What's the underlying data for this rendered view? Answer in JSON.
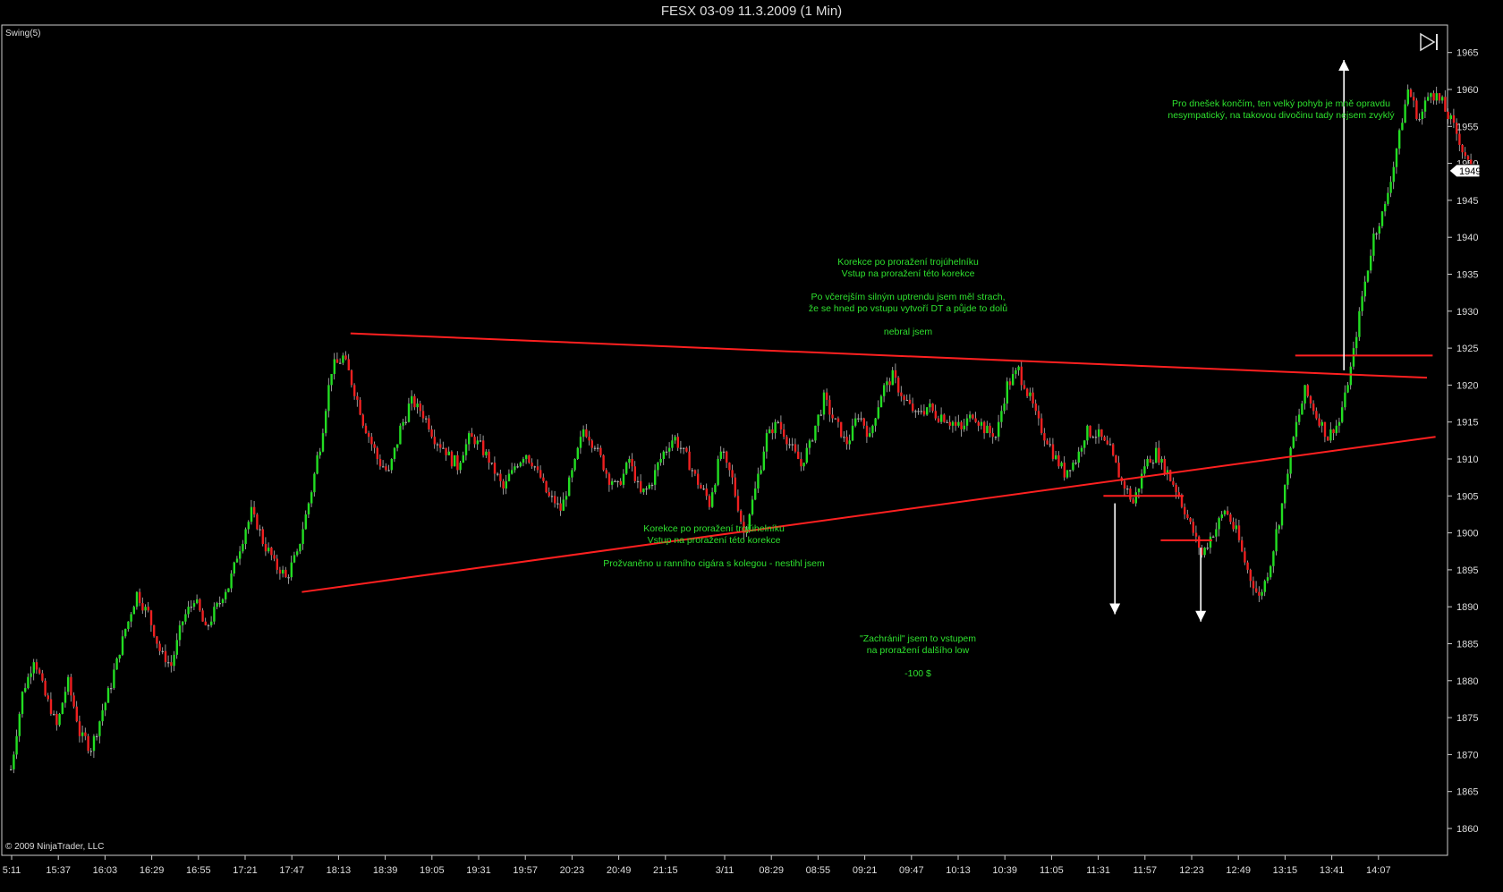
{
  "window": {
    "title": "FESX 03-09  11.3.2009 (1 Min)"
  },
  "indicator_label": "Swing(5)",
  "copyright": "© 2009 NinjaTrader, LLC",
  "price_marker": "1949",
  "icons": {
    "playback": "skip-forward-icon"
  },
  "colors": {
    "background": "#000000",
    "up_bar": "#22dd22",
    "down_bar": "#ee2020",
    "neutral_bar": "#aaaaaa",
    "trendline": "#ff2020",
    "annotation_text": "#2ee02e",
    "arrow": "#ffffff",
    "axis_text": "#dddddd"
  },
  "annotations": [
    {
      "id": "a1",
      "text": "Pro dnešek končím, ten velký pohyb je mně opravdu\nnesympatický, na takovou divočinu tady nejsem zvyklý"
    },
    {
      "id": "a2",
      "text": "Korekce po proražení trojúhelníku\nVstup na proražení této korekce\n\nPo včerejším silným uptrendu jsem měl strach,\nže se hned po vstupu vytvoří DT a půjde to dolů\n\nnebral jsem"
    },
    {
      "id": "a3",
      "text": "Korekce po proražení trojúhelníku\nVstup na proražení této korekce\n\nProžvaněno u ranního cigára s kolegou - nestihl jsem"
    },
    {
      "id": "a4",
      "text": "\"Zachránil\" jsem to vstupem\nna proražení dalšího low\n\n-100 $"
    }
  ],
  "chart_data": {
    "type": "candlestick",
    "title": "FESX 03-09  11.3.2009 (1 Min)",
    "y_axis": {
      "ticks": [
        1860,
        1865,
        1870,
        1875,
        1880,
        1885,
        1890,
        1895,
        1900,
        1905,
        1910,
        1915,
        1920,
        1925,
        1930,
        1935,
        1940,
        1945,
        1950,
        1955,
        1960,
        1965
      ],
      "range": [
        1857,
        1970
      ],
      "side": "right"
    },
    "x_axis": {
      "ticks": [
        "5:11",
        "15:37",
        "16:03",
        "16:29",
        "16:55",
        "17:21",
        "17:47",
        "18:13",
        "18:39",
        "19:05",
        "19:31",
        "19:57",
        "20:23",
        "20:49",
        "21:15",
        "3/11",
        "08:29",
        "08:55",
        "09:21",
        "09:47",
        "10:13",
        "10:39",
        "11:05",
        "11:31",
        "11:57",
        "12:23",
        "12:49",
        "13:15",
        "13:41",
        "14:07"
      ]
    },
    "close_path": [
      [
        0,
        1868
      ],
      [
        4,
        1878
      ],
      [
        8,
        1883
      ],
      [
        12,
        1878
      ],
      [
        16,
        1874
      ],
      [
        20,
        1880
      ],
      [
        24,
        1873
      ],
      [
        28,
        1871
      ],
      [
        32,
        1876
      ],
      [
        36,
        1881
      ],
      [
        40,
        1887
      ],
      [
        44,
        1892
      ],
      [
        48,
        1889
      ],
      [
        52,
        1884
      ],
      [
        56,
        1882
      ],
      [
        60,
        1888
      ],
      [
        64,
        1891
      ],
      [
        68,
        1887
      ],
      [
        72,
        1890
      ],
      [
        76,
        1893
      ],
      [
        80,
        1898
      ],
      [
        84,
        1903
      ],
      [
        88,
        1899
      ],
      [
        92,
        1896
      ],
      [
        96,
        1894
      ],
      [
        100,
        1897
      ],
      [
        104,
        1904
      ],
      [
        108,
        1912
      ],
      [
        112,
        1922
      ],
      [
        116,
        1924
      ],
      [
        120,
        1919
      ],
      [
        124,
        1914
      ],
      [
        128,
        1910
      ],
      [
        132,
        1908
      ],
      [
        136,
        1914
      ],
      [
        140,
        1918
      ],
      [
        144,
        1916
      ],
      [
        148,
        1913
      ],
      [
        152,
        1911
      ],
      [
        156,
        1909
      ],
      [
        160,
        1913
      ],
      [
        164,
        1912
      ],
      [
        168,
        1909
      ],
      [
        172,
        1906
      ],
      [
        176,
        1909
      ],
      [
        180,
        1911
      ],
      [
        184,
        1908
      ],
      [
        188,
        1905
      ],
      [
        192,
        1903
      ],
      [
        196,
        1908
      ],
      [
        200,
        1914
      ],
      [
        204,
        1912
      ],
      [
        208,
        1908
      ],
      [
        212,
        1906
      ],
      [
        216,
        1910
      ],
      [
        220,
        1905
      ],
      [
        224,
        1907
      ],
      [
        228,
        1911
      ],
      [
        232,
        1913
      ],
      [
        236,
        1910
      ],
      [
        240,
        1907
      ],
      [
        244,
        1904
      ],
      [
        248,
        1911
      ],
      [
        252,
        1907
      ],
      [
        256,
        1900
      ],
      [
        260,
        1906
      ],
      [
        264,
        1913
      ],
      [
        268,
        1915
      ],
      [
        272,
        1912
      ],
      [
        276,
        1909
      ],
      [
        280,
        1913
      ],
      [
        284,
        1918
      ],
      [
        288,
        1915
      ],
      [
        292,
        1912
      ],
      [
        296,
        1916
      ],
      [
        300,
        1913
      ],
      [
        304,
        1919
      ],
      [
        308,
        1921
      ],
      [
        312,
        1918
      ],
      [
        316,
        1916
      ],
      [
        320,
        1917
      ],
      [
        324,
        1916
      ],
      [
        328,
        1915
      ],
      [
        332,
        1914
      ],
      [
        336,
        1916
      ],
      [
        340,
        1914
      ],
      [
        344,
        1913
      ],
      [
        348,
        1920
      ],
      [
        352,
        1922
      ],
      [
        356,
        1918
      ],
      [
        360,
        1914
      ],
      [
        364,
        1911
      ],
      [
        368,
        1908
      ],
      [
        372,
        1910
      ],
      [
        376,
        1914
      ],
      [
        380,
        1913
      ],
      [
        384,
        1911
      ],
      [
        388,
        1907
      ],
      [
        392,
        1904
      ],
      [
        396,
        1909
      ],
      [
        400,
        1911
      ],
      [
        404,
        1908
      ],
      [
        408,
        1905
      ],
      [
        412,
        1901
      ],
      [
        416,
        1897
      ],
      [
        420,
        1900
      ],
      [
        424,
        1903
      ],
      [
        428,
        1900
      ],
      [
        432,
        1895
      ],
      [
        436,
        1891
      ],
      [
        440,
        1896
      ],
      [
        444,
        1904
      ],
      [
        448,
        1913
      ],
      [
        452,
        1919
      ],
      [
        456,
        1916
      ],
      [
        460,
        1913
      ],
      [
        464,
        1915
      ],
      [
        468,
        1922
      ],
      [
        472,
        1932
      ],
      [
        476,
        1940
      ],
      [
        480,
        1944
      ],
      [
        484,
        1952
      ],
      [
        488,
        1960
      ],
      [
        492,
        1956
      ],
      [
        496,
        1960
      ],
      [
        500,
        1958
      ],
      [
        504,
        1955
      ],
      [
        508,
        1951
      ],
      [
        510,
        1949
      ]
    ],
    "trendlines": [
      {
        "name": "triangle-upper",
        "from": [
          119,
          1927
        ],
        "to": [
          495,
          1921
        ]
      },
      {
        "name": "triangle-lower",
        "from": [
          102,
          1892
        ],
        "to": [
          498,
          1913
        ]
      },
      {
        "name": "entry-level-1",
        "from": [
          449,
          1924
        ],
        "to": [
          497,
          1924
        ]
      },
      {
        "name": "entry-level-2",
        "from": [
          382,
          1905
        ],
        "to": [
          410,
          1905
        ]
      },
      {
        "name": "entry-level-3",
        "from": [
          402,
          1899
        ],
        "to": [
          420,
          1899
        ]
      }
    ],
    "arrows": [
      {
        "direction": "up",
        "at": [
          466,
          1922
        ],
        "to": [
          466,
          1964
        ]
      },
      {
        "direction": "down",
        "at": [
          386,
          1904
        ],
        "to": [
          386,
          1889
        ]
      },
      {
        "direction": "down",
        "at": [
          416,
          1898
        ],
        "to": [
          416,
          1888
        ]
      }
    ]
  }
}
